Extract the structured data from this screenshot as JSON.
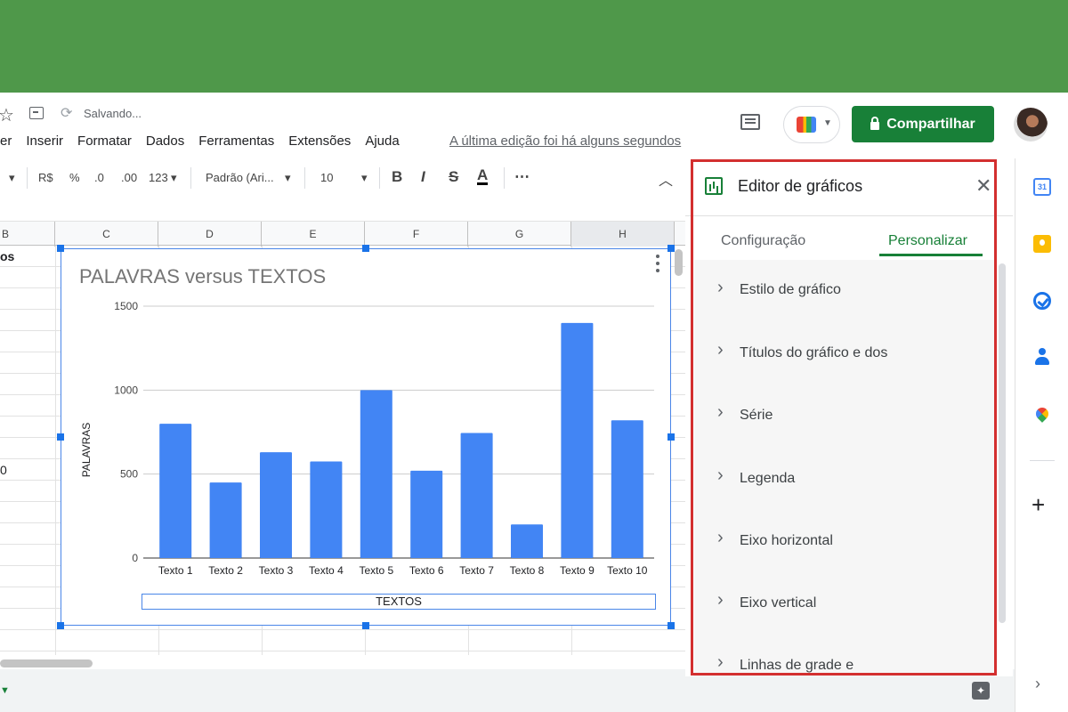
{
  "header": {
    "saving_text": "Salvando...",
    "menu": [
      "er",
      "Inserir",
      "Formatar",
      "Dados",
      "Ferramentas",
      "Extensões",
      "Ajuda"
    ],
    "last_edit": "A última edição foi há alguns segundos",
    "share_label": "Compartilhar"
  },
  "toolbar": {
    "currency": "R$",
    "percent": "%",
    "dec_less": ".0",
    "dec_more": ".00",
    "format_more": "123",
    "font": "Padrão (Ari...",
    "font_size": "10",
    "bold": "B",
    "italic": "I",
    "strike": "S",
    "text_color": "A",
    "more": "⋯"
  },
  "grid": {
    "columns": [
      "B",
      "C",
      "D",
      "E",
      "F",
      "G",
      "H"
    ],
    "cell_b_header": "os",
    "cell_b_value": "0"
  },
  "chart_data": {
    "type": "bar",
    "title": "PALAVRAS versus TEXTOS",
    "xlabel": "TEXTOS",
    "ylabel": "PALAVRAS",
    "categories": [
      "Texto 1",
      "Texto 2",
      "Texto 3",
      "Texto 4",
      "Texto 5",
      "Texto 6",
      "Texto 7",
      "Texto 8",
      "Texto 9",
      "Texto 10"
    ],
    "values": [
      800,
      450,
      630,
      575,
      1000,
      520,
      745,
      200,
      1400,
      820
    ],
    "yticks": [
      "0",
      "500",
      "1000",
      "1500"
    ],
    "ylim": [
      0,
      1500
    ],
    "bar_color": "#4285f4",
    "grid": true
  },
  "editor": {
    "title": "Editor de gráficos",
    "tabs": [
      "Configuração",
      "Personalizar"
    ],
    "active_tab": "Personalizar",
    "sections": [
      "Estilo de gráfico",
      "Títulos do gráfico e dos",
      "Série",
      "Legenda",
      "Eixo horizontal",
      "Eixo vertical",
      "Linhas de grade e"
    ]
  },
  "side_panel": {
    "calendar_day": "31"
  }
}
